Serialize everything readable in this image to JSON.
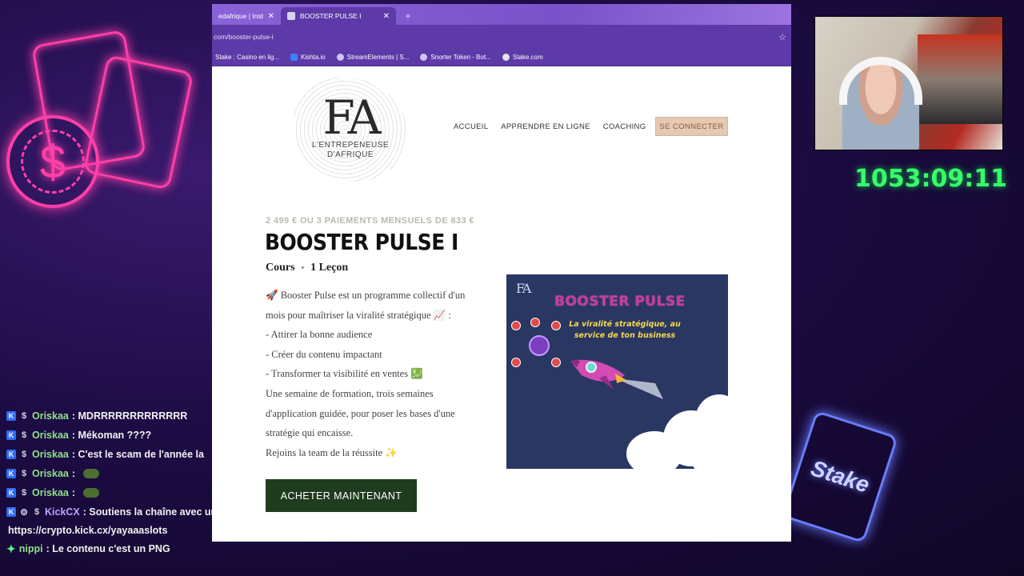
{
  "browser": {
    "tabs": [
      {
        "title": "edafrique | Insta",
        "active": false
      },
      {
        "title": "BOOSTER PULSE I",
        "active": true
      }
    ],
    "url": "com/booster-pulse-i",
    "bookmarks": [
      "Stake : Casino en lig...",
      "Kishta.io",
      "StreamElements | S...",
      "Snorter Token - Bot...",
      "Stake.com"
    ]
  },
  "site": {
    "logo_mark": "FA",
    "logo_text_1": "L'ENTREPENEUSE",
    "logo_text_2": "D'AFRIQUE",
    "nav": [
      "ACCUEIL",
      "APPRENDRE EN LIGNE",
      "COACHING"
    ],
    "nav_cta": "SE CONNECTER",
    "price": "2 499 € OU 3 PAIEMENTS MENSUELS DE 833 €",
    "title": "BOOSTER PULSE I",
    "meta_type": "Cours",
    "meta_lessons": "1 Leçon",
    "description": [
      "🚀 Booster Pulse est un programme collectif d'un",
      "mois pour maîtriser la viralité stratégique 📈 :",
      "- Attirer la bonne audience",
      "- Créer du contenu impactant",
      "- Transformer ta visibilité en ventes 💹",
      " Une semaine de formation, trois semaines",
      "d'application guidée, pour poser les bases d'une",
      "stratégie qui encaisse.",
      "Rejoins la team de la réussite ✨"
    ],
    "buy_button": "ACHETER MAINTENANT",
    "promo": {
      "logo": "FA",
      "title": "BOOSTER PULSE",
      "subtitle_1": "La viralité stratégique, au",
      "subtitle_2": "service de ton business"
    }
  },
  "overlay": {
    "timer": "1053:09:11",
    "stake_label": "Stake"
  },
  "chat": [
    {
      "user": "Oriskaa",
      "msg": ": MDRRRRRRRRRRRRR"
    },
    {
      "user": "Oriskaa",
      "msg": ": Mékoman ????"
    },
    {
      "user": "Oriskaa",
      "msg": ": C'est le scam de l'année la"
    },
    {
      "user": "Oriskaa",
      "msg": ":"
    },
    {
      "user": "Oriskaa",
      "msg": ":"
    },
    {
      "user": "KickCX",
      "msg": ": Soutiens la chaîne avec un don en crypto sur",
      "cont": "https://crypto.kick.cx/yayaaaslots"
    },
    {
      "user": "nippi",
      "msg": ": Le contenu c'est un PNG"
    }
  ]
}
